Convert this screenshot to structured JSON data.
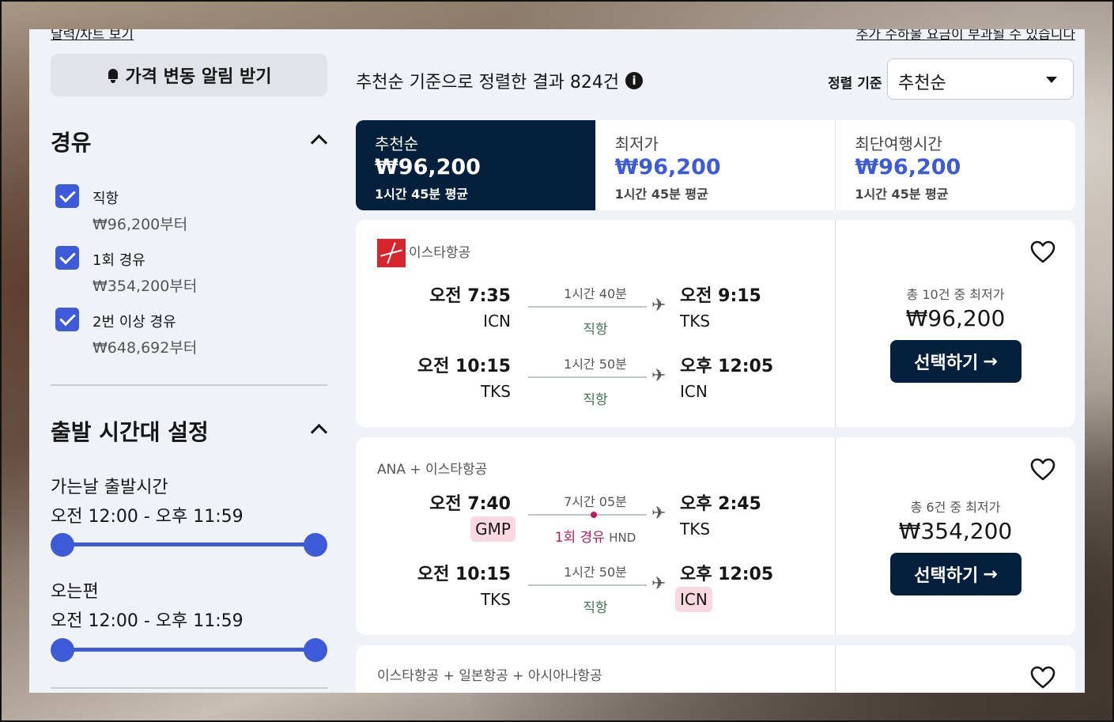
{
  "filters": {
    "calendar_link": "달력/차트 보기",
    "price_alert_label": "가격 변동 알림 받기",
    "stops": {
      "title": "경유",
      "items": [
        {
          "label": "직항",
          "price": "₩96,200부터",
          "checked": true
        },
        {
          "label": "1회 경유",
          "price": "₩354,200부터",
          "checked": true
        },
        {
          "label": "2번 이상 경유",
          "price": "₩648,692부터",
          "checked": true
        }
      ]
    },
    "times": {
      "title": "출발 시간대 설정",
      "outbound_label": "가는날 출발시간",
      "outbound_range": "오전 12:00 - 오후 11:59",
      "return_label": "오는편",
      "return_range": "오전 12:00 - 오후 11:59"
    }
  },
  "results": {
    "fee_notice": "추가 수하물 요금이 부과될 수 있습니다",
    "count_text": "추천순 기준으로 정렬한 결과 824건",
    "sort_label": "정렬 기준",
    "sort_value": "추천순",
    "tabs": [
      {
        "name": "추천순",
        "price": "₩96,200",
        "duration": "1시간 45분 평균",
        "active": true
      },
      {
        "name": "최저가",
        "price": "₩96,200",
        "duration": "1시간 45분 평균",
        "active": false
      },
      {
        "name": "최단여행시간",
        "price": "₩96,200",
        "duration": "1시간 45분 평균",
        "active": false
      }
    ],
    "cards": [
      {
        "airline": "이스타항공",
        "legs": [
          {
            "dep_time": "오전 7:35",
            "dep_code": "ICN",
            "duration": "1시간 40분",
            "stops": "직항",
            "arr_time": "오전 9:15",
            "arr_code": "TKS"
          },
          {
            "dep_time": "오전 10:15",
            "dep_code": "TKS",
            "duration": "1시간 50분",
            "stops": "직항",
            "arr_time": "오후 12:05",
            "arr_code": "ICN"
          }
        ],
        "deal_text": "총 10건 중 최저가",
        "price": "₩96,200",
        "select_label": "선택하기"
      },
      {
        "airline": "ANA + 이스타항공",
        "legs": [
          {
            "dep_time": "오전 7:40",
            "dep_code": "GMP",
            "duration": "7시간 05분",
            "stops": "1회 경유",
            "via": "HND",
            "arr_time": "오후 2:45",
            "arr_code": "TKS"
          },
          {
            "dep_time": "오전 10:15",
            "dep_code": "TKS",
            "duration": "1시간 50분",
            "stops": "직항",
            "arr_time": "오후 12:05",
            "arr_code": "ICN"
          }
        ],
        "deal_text": "총 6건 중 최저가",
        "price": "₩354,200",
        "select_label": "선택하기"
      },
      {
        "airline": "이스타항공 + 일본항공 + 아시아나항공"
      }
    ]
  },
  "colors": {
    "accent": "#3d5bd9",
    "navy": "#05203c",
    "highlight": "#f9d8e2",
    "layover": "#c2185b"
  },
  "icons": [
    "bell-icon",
    "chevron-up-icon",
    "check-icon",
    "info-icon",
    "caret-down-icon",
    "plane-icon",
    "heart-icon",
    "arrow-right-icon"
  ]
}
